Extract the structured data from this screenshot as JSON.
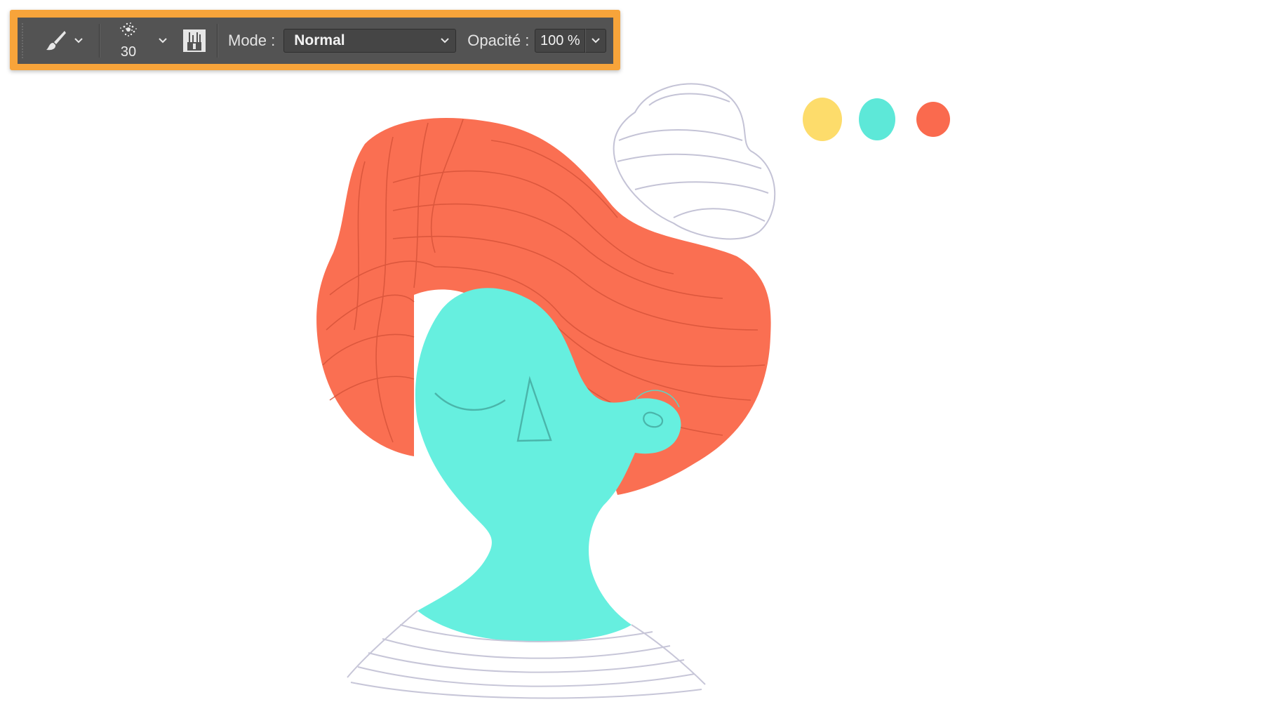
{
  "options_bar": {
    "tool_icon": "brush-icon",
    "brush_size": "30",
    "brush_preset_icon": "brush-tip-icon",
    "brush_panel_icon": "brush-settings-panel-icon",
    "mode_label": "Mode :",
    "mode_value": "Normal",
    "opacity_label": "Opacité :",
    "opacity_value": "100 %",
    "highlight_color": "#f7a43a"
  },
  "canvas": {
    "swatches": [
      {
        "name": "yellow",
        "color": "#fddc6b"
      },
      {
        "name": "turquoise",
        "color": "#5de8d8"
      },
      {
        "name": "coral",
        "color": "#fa6a4e"
      }
    ],
    "hair_color": "#fa6f52",
    "skin_color": "#66efdf",
    "sketch_line_color": "#b9b8cc"
  }
}
